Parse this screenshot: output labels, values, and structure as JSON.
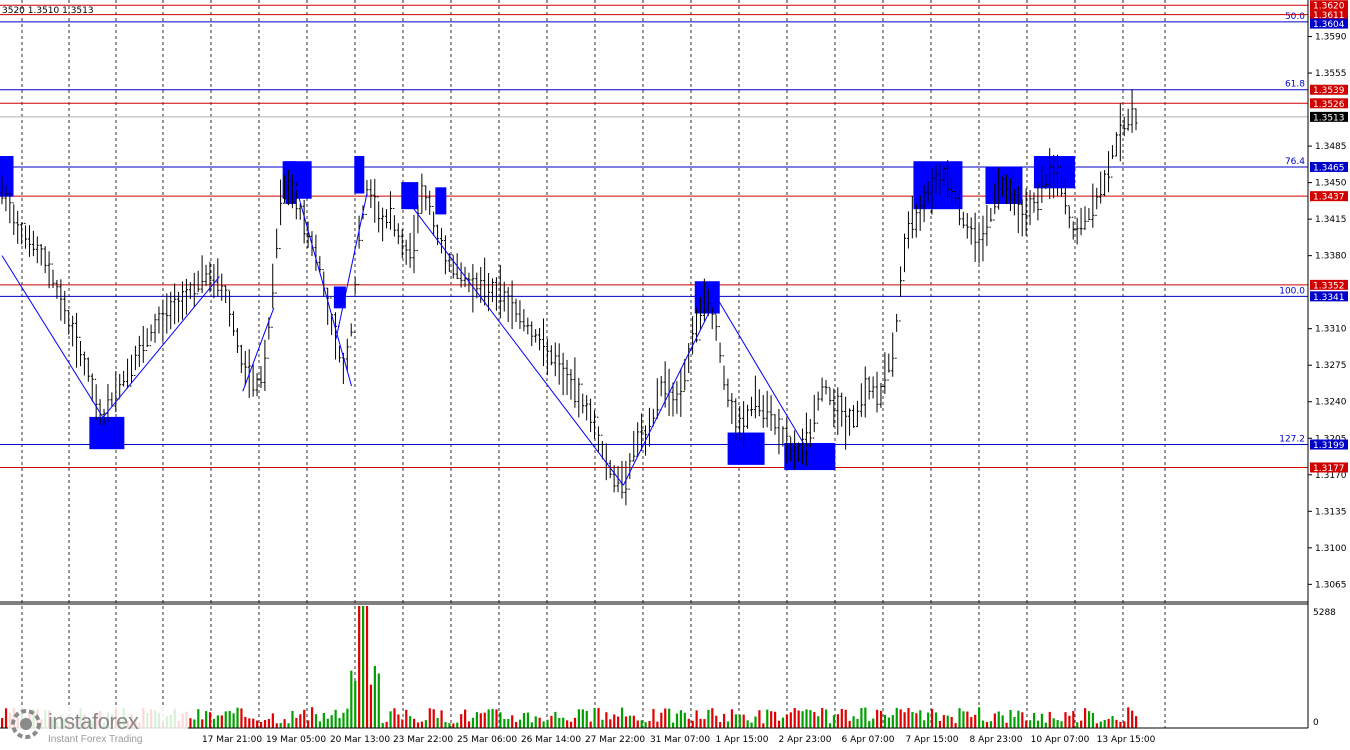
{
  "header_text": "3520 1.3510 1.3513",
  "logo": {
    "name": "instaforex",
    "sub": "Instant Forex Trading"
  },
  "colors": {
    "fib": "#0000c8",
    "support": "#d00000",
    "box": "#0000ff",
    "bull": "#00a000",
    "bear": "#e00000"
  },
  "chart_data": {
    "type": "line",
    "ylim": [
      1.305,
      1.3625
    ],
    "yticks": [
      "1.3590",
      "1.3555",
      "1.3485",
      "1.3450",
      "1.3415",
      "1.3380",
      "1.3310",
      "1.3275",
      "1.3240",
      "1.3205",
      "1.3170",
      "1.3135",
      "1.3100",
      "1.3065"
    ],
    "xticks": [
      "17 Mar 21:00",
      "19 Mar 05:00",
      "20 Mar 13:00",
      "23 Mar 22:00",
      "25 Mar 06:00",
      "26 Mar 14:00",
      "27 Mar 22:00",
      "31 Mar 07:00",
      "1 Apr 15:00",
      "2 Apr 23:00",
      "6 Apr 07:00",
      "7 Apr 15:00",
      "8 Apr 23:00",
      "10 Apr 07:00",
      "13 Apr 15:00"
    ],
    "price_line": [
      [
        0,
        1.344
      ],
      [
        2,
        1.341
      ],
      [
        4,
        1.339
      ],
      [
        6,
        1.337
      ],
      [
        8,
        1.333
      ],
      [
        9,
        1.331
      ],
      [
        10,
        1.329
      ],
      [
        11,
        1.327
      ],
      [
        12,
        1.324
      ],
      [
        13,
        1.3225
      ],
      [
        14,
        1.324
      ],
      [
        15,
        1.3255
      ],
      [
        16,
        1.3265
      ],
      [
        18,
        1.329
      ],
      [
        20,
        1.3315
      ],
      [
        22,
        1.333
      ],
      [
        24,
        1.3345
      ],
      [
        26,
        1.336
      ],
      [
        28,
        1.3355
      ],
      [
        29,
        1.334
      ],
      [
        30,
        1.331
      ],
      [
        31,
        1.3275
      ],
      [
        32,
        1.326
      ],
      [
        33,
        1.3255
      ],
      [
        34,
        1.328
      ],
      [
        35,
        1.336
      ],
      [
        36,
        1.344
      ],
      [
        37,
        1.3445
      ],
      [
        38,
        1.343
      ],
      [
        39,
        1.341
      ],
      [
        40,
        1.339
      ],
      [
        41,
        1.337
      ],
      [
        42,
        1.333
      ],
      [
        43,
        1.33
      ],
      [
        44,
        1.327
      ],
      [
        45,
        1.331
      ],
      [
        46,
        1.34
      ],
      [
        47,
        1.3445
      ],
      [
        48,
        1.343
      ],
      [
        49,
        1.341
      ],
      [
        50,
        1.342
      ],
      [
        51,
        1.34
      ],
      [
        52,
        1.338
      ],
      [
        53,
        1.339
      ],
      [
        54,
        1.344
      ],
      [
        55,
        1.343
      ],
      [
        56,
        1.34
      ],
      [
        57,
        1.3385
      ],
      [
        58,
        1.337
      ],
      [
        60,
        1.3355
      ],
      [
        62,
        1.335
      ],
      [
        64,
        1.3345
      ],
      [
        66,
        1.333
      ],
      [
        68,
        1.331
      ],
      [
        70,
        1.329
      ],
      [
        72,
        1.327
      ],
      [
        74,
        1.325
      ],
      [
        76,
        1.3225
      ],
      [
        77,
        1.32
      ],
      [
        78,
        1.318
      ],
      [
        79,
        1.3165
      ],
      [
        80,
        1.316
      ],
      [
        81,
        1.3185
      ],
      [
        82,
        1.321
      ],
      [
        83,
        1.32
      ],
      [
        84,
        1.323
      ],
      [
        85,
        1.326
      ],
      [
        86,
        1.325
      ],
      [
        87,
        1.324
      ],
      [
        88,
        1.327
      ],
      [
        89,
        1.33
      ],
      [
        90,
        1.333
      ],
      [
        91,
        1.3335
      ],
      [
        92,
        1.331
      ],
      [
        93,
        1.326
      ],
      [
        94,
        1.323
      ],
      [
        95,
        1.3215
      ],
      [
        96,
        1.3225
      ],
      [
        97,
        1.3245
      ],
      [
        98,
        1.323
      ],
      [
        99,
        1.3225
      ],
      [
        100,
        1.3215
      ],
      [
        101,
        1.32
      ],
      [
        102,
        1.319
      ],
      [
        103,
        1.3195
      ],
      [
        104,
        1.321
      ],
      [
        105,
        1.324
      ],
      [
        106,
        1.3255
      ],
      [
        107,
        1.324
      ],
      [
        108,
        1.323
      ],
      [
        109,
        1.322
      ],
      [
        110,
        1.3225
      ],
      [
        111,
        1.325
      ],
      [
        112,
        1.3255
      ],
      [
        113,
        1.3245
      ],
      [
        114,
        1.327
      ],
      [
        115,
        1.33
      ],
      [
        116,
        1.338
      ],
      [
        117,
        1.341
      ],
      [
        118,
        1.342
      ],
      [
        119,
        1.344
      ],
      [
        120,
        1.345
      ],
      [
        121,
        1.346
      ],
      [
        122,
        1.345
      ],
      [
        123,
        1.343
      ],
      [
        124,
        1.341
      ],
      [
        125,
        1.34
      ],
      [
        126,
        1.3395
      ],
      [
        127,
        1.341
      ],
      [
        128,
        1.344
      ],
      [
        129,
        1.345
      ],
      [
        130,
        1.344
      ],
      [
        131,
        1.342
      ],
      [
        132,
        1.3425
      ],
      [
        133,
        1.343
      ],
      [
        134,
        1.3445
      ],
      [
        135,
        1.346
      ],
      [
        136,
        1.3455
      ],
      [
        137,
        1.343
      ],
      [
        138,
        1.34
      ],
      [
        139,
        1.341
      ],
      [
        140,
        1.342
      ],
      [
        141,
        1.3435
      ],
      [
        142,
        1.345
      ],
      [
        143,
        1.348
      ],
      [
        144,
        1.35
      ],
      [
        145,
        1.351
      ],
      [
        146,
        1.3513
      ]
    ],
    "price_range": [
      0,
      146
    ],
    "fib_levels": [
      {
        "label": "50.0",
        "value": 1.3604
      },
      {
        "label": "61.8",
        "value": 1.3539
      },
      {
        "label": "76.4",
        "value": 1.3465
      },
      {
        "label": "100.0",
        "value": 1.3341
      },
      {
        "label": "127.2",
        "value": 1.3199
      }
    ],
    "support_levels": [
      1.362,
      1.3611,
      1.3526,
      1.3437,
      1.3352,
      1.3177
    ],
    "price_tags": [
      {
        "label": "1.3620",
        "value": 1.362,
        "kind": "support"
      },
      {
        "label": "1.3611",
        "value": 1.3611,
        "kind": "support"
      },
      {
        "label": "1.3604",
        "value": 1.3604,
        "kind": "fib"
      },
      {
        "label": "1.3539",
        "value": 1.3539,
        "kind": "support"
      },
      {
        "label": "1.3526",
        "value": 1.3526,
        "kind": "support"
      },
      {
        "label": "1.3513",
        "value": 1.3513,
        "kind": "current"
      },
      {
        "label": "1.3465",
        "value": 1.3465,
        "kind": "fib"
      },
      {
        "label": "1.3437",
        "value": 1.3437,
        "kind": "support"
      },
      {
        "label": "1.3352",
        "value": 1.3352,
        "kind": "support"
      },
      {
        "label": "1.3341",
        "value": 1.3341,
        "kind": "fib"
      },
      {
        "label": "1.3199",
        "value": 1.3199,
        "kind": "fib"
      },
      {
        "label": "1.3177",
        "value": 1.3177,
        "kind": "support"
      }
    ],
    "current_price": 1.3513,
    "volume_ticks": [
      "5288",
      "0"
    ],
    "volume_max": 5288
  }
}
